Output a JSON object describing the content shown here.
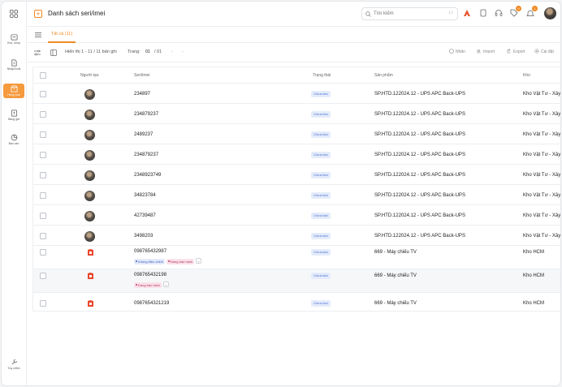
{
  "nav": {
    "items": [
      {
        "label": "Kho, shop",
        "icon": "shop-icon"
      },
      {
        "label": "Nhập/Xuất",
        "icon": "import-export-icon"
      },
      {
        "label": "Hàng hóa",
        "icon": "goods-icon",
        "active": true
      },
      {
        "label": "Bảng giá",
        "icon": "price-list-icon"
      },
      {
        "label": "Báo cáo",
        "icon": "report-icon"
      }
    ],
    "bottom_label": "Tùy chỉnh"
  },
  "header": {
    "title": "Danh sách seri/imei",
    "search_placeholder": "Tìm kiếm",
    "badges": {
      "promo": "9",
      "notifications": "1"
    }
  },
  "tabs": {
    "all_label": "Tất cả (11)"
  },
  "toolbar": {
    "summary": "Hiển thị 1 - 11 / 11 bản ghi",
    "page_label": "Trang:",
    "page_current": "01",
    "page_total": "/ 01",
    "label_btn": "Nhãn",
    "import_btn": "Import",
    "export_btn": "Export",
    "settings_btn": "Cài đặt"
  },
  "table": {
    "columns": [
      "Người tạo",
      "Seri/imei",
      "Trạng thái",
      "Sản phẩm",
      "Kho"
    ],
    "rows": [
      {
        "serial": "234897",
        "status": "Chưa bán",
        "product": "SP.HTD.122024.12 - UPS APC Back-UPS",
        "warehouse": "Kho Vật Tư - Xây Dựng",
        "avatar": "photo",
        "tags": []
      },
      {
        "serial": "234879237",
        "status": "Chưa bán",
        "product": "SP.HTD.122024.12 - UPS APC Back-UPS",
        "warehouse": "Kho Vật Tư - Xây Dựng",
        "avatar": "photo",
        "tags": []
      },
      {
        "serial": "2489237",
        "status": "Chưa bán",
        "product": "SP.HTD.122024.12 - UPS APC Back-UPS",
        "warehouse": "Kho Vật Tư - Xây Dựng",
        "avatar": "photo",
        "tags": []
      },
      {
        "serial": "234879237",
        "status": "Chưa bán",
        "product": "SP.HTD.122024.12 - UPS APC Back-UPS",
        "warehouse": "Kho Vật Tư - Xây Dựng",
        "avatar": "photo",
        "tags": []
      },
      {
        "serial": "2348923749",
        "status": "Chưa bán",
        "product": "SP.HTD.122024.12 - UPS APC Back-UPS",
        "warehouse": "Kho Vật Tư - Xây Dựng",
        "avatar": "photo",
        "tags": []
      },
      {
        "serial": "34823784",
        "status": "Chưa bán",
        "product": "SP.HTD.122024.12 - UPS APC Back-UPS",
        "warehouse": "Kho Vật Tư - Xây Dựng",
        "avatar": "photo",
        "tags": []
      },
      {
        "serial": "42739487",
        "status": "Chưa bán",
        "product": "SP.HTD.122024.12 - UPS APC Back-UPS",
        "warehouse": "Kho Vật Tư - Xây Dựng",
        "avatar": "photo",
        "tags": []
      },
      {
        "serial": "3498203",
        "status": "Chưa bán",
        "product": "SP.HTD.122024.12 - UPS APC Back-UPS",
        "warehouse": "Kho Vật Tư - Xây Dựng",
        "avatar": "photo",
        "tags": []
      },
      {
        "serial": "098765432987",
        "status": "Chưa bán",
        "product": "669 - Máy chiếu TV",
        "warehouse": "Kho HCM",
        "avatar": "logo",
        "tags": [
          {
            "text": "Không điều chỉnh",
            "color": "blue"
          },
          {
            "text": "Đang bảo hành",
            "color": "pink"
          }
        ],
        "more": "+"
      },
      {
        "serial": "098765432198",
        "status": "Chưa bán",
        "product": "669 - Máy chiếu TV",
        "warehouse": "Kho HCM",
        "avatar": "logo",
        "tags": [
          {
            "text": "Đang bảo hành",
            "color": "pink"
          }
        ],
        "more": "+"
      },
      {
        "serial": "0987654321219",
        "status": "Chưa bán",
        "product": "669 - Máy chiếu TV",
        "warehouse": "Kho HCM",
        "avatar": "logo",
        "tags": []
      }
    ]
  },
  "colors": {
    "accent": "#f08a24",
    "status_bg": "#e4ecfb",
    "status_text": "#4a6fd0"
  }
}
